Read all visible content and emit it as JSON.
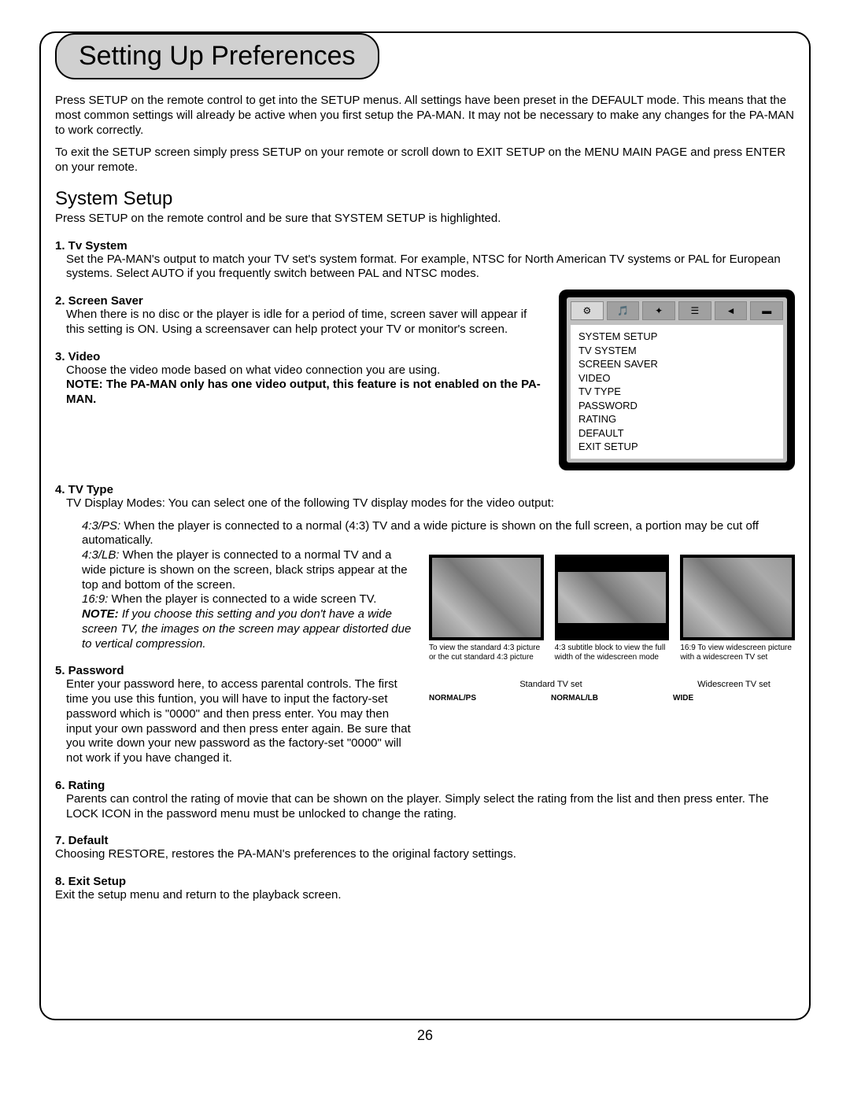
{
  "title": "Setting Up Preferences",
  "intro1": "Press SETUP on the remote control to get into the SETUP menus. All settings have been preset in the DEFAULT mode. This means that the most common settings will already be active when you first setup the PA-MAN. It may not be necessary to make any changes for the PA-MAN to work correctly.",
  "intro2": "To exit the SETUP screen simply press SETUP on your remote or scroll down to EXIT SETUP on the MENU MAIN PAGE and press ENTER on your remote.",
  "section": {
    "heading": "System Setup",
    "text": "Press SETUP on the remote control and be sure that SYSTEM SETUP is highlighted."
  },
  "items": {
    "1": {
      "h": "1. Tv System",
      "t": "Set the PA-MAN's output to match your TV set's system format. For example, NTSC for North American TV systems or PAL for European systems. Select AUTO if you frequently switch between PAL and NTSC modes."
    },
    "2": {
      "h": "2. Screen Saver",
      "t": "When there is no disc or the player is idle for a period of time, screen saver will appear if this setting is ON. Using a screensaver can help protect your TV or monitor's screen."
    },
    "3": {
      "h": "3. Video",
      "t": "Choose the video mode based on what video connection you are using.",
      "note": "NOTE: The PA-MAN only has one video output, this feature is not enabled on the PA-MAN."
    },
    "4": {
      "h": "4. TV Type",
      "t": "TV Display Modes: You can select one of the following TV display modes for the video output:"
    },
    "5": {
      "h": "5. Password",
      "t": "Enter your password here, to access parental controls. The first time you use this funtion, you will have to input the factory-set password which is \"0000\" and then press enter. You may then input your own password and then press enter again. Be sure that you write down your new password as the factory-set \"0000\" will not work if you have changed it."
    },
    "6": {
      "h": "6. Rating",
      "t": "Parents can control the rating of movie that can be shown on the player. Simply select the rating from the list and then press enter. The LOCK ICON in the password menu must be unlocked to change the rating."
    },
    "7": {
      "h": "7. Default",
      "t": "Choosing RESTORE, restores the PA-MAN's preferences to the original factory settings."
    },
    "8": {
      "h": "8. Exit Setup",
      "t": "Exit the setup menu and return to the playback screen."
    }
  },
  "tvmodes": {
    "ps": {
      "label": "4:3/PS:",
      "text": " When the player is connected to a normal (4:3) TV and a wide picture is shown on the full screen, a portion may be cut off automatically."
    },
    "lb": {
      "label": "4:3/LB:",
      "text": " When the player is connected to a normal TV and a wide picture is shown on the screen, black strips appear at the top and bottom of the screen."
    },
    "ws": {
      "label": "16:9:",
      "text": " When the player is connected to a wide screen TV."
    },
    "note_label": "NOTE:",
    "note_text": " If you choose this setting and you don't have a wide screen TV, the images on the screen may appear distorted due to vertical compression."
  },
  "setup_menu": [
    "SYSTEM SETUP",
    "TV SYSTEM",
    "SCREEN SAVER",
    "VIDEO",
    "TV TYPE",
    "PASSWORD",
    "RATING",
    "DEFAULT",
    "EXIT SETUP"
  ],
  "gallery": {
    "cap1": "To view the standard 4:3 picture or the cut standard 4:3 picture",
    "cap2": "4:3 subtitle block to view the full width of the widescreen mode",
    "cap3": "16:9 To view widescreen picture with a widescreen TV set",
    "std": "Standard TV set",
    "wide": "Widescreen TV set",
    "label1": "NORMAL/PS",
    "label2": "NORMAL/LB",
    "label3": "WIDE"
  },
  "page_num": "26"
}
